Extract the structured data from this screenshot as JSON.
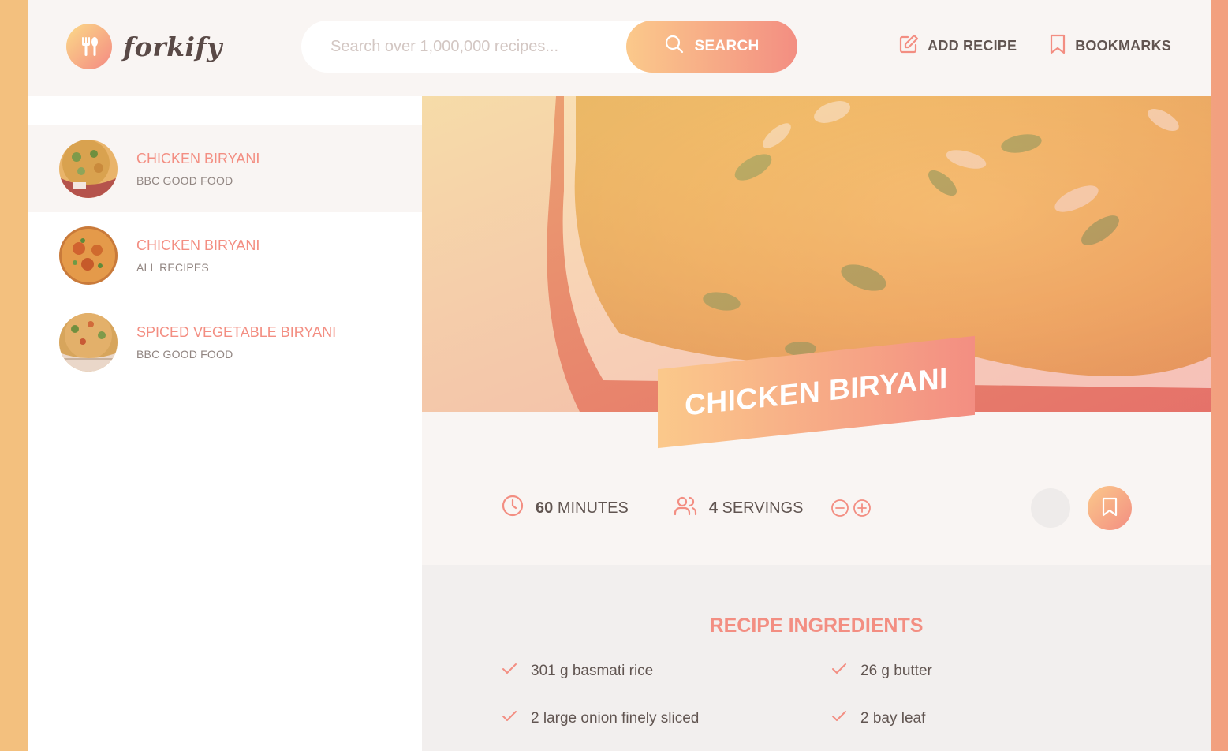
{
  "header": {
    "logo_text": "forkify",
    "search": {
      "placeholder": "Search over 1,000,000 recipes...",
      "button_label": "SEARCH"
    },
    "nav": {
      "add_recipe": "ADD RECIPE",
      "bookmarks": "BOOKMARKS"
    }
  },
  "results": [
    {
      "title": "CHICKEN BIRYANI",
      "publisher": "BBC GOOD FOOD",
      "active": true
    },
    {
      "title": "CHICKEN BIRYANI",
      "publisher": "ALL RECIPES",
      "active": false
    },
    {
      "title": "SPICED VEGETABLE BIRYANI",
      "publisher": "BBC GOOD FOOD",
      "active": false
    }
  ],
  "recipe": {
    "title": "CHICKEN BIRYANI",
    "cooking_time": "60",
    "cooking_time_unit": "MINUTES",
    "servings": "4",
    "servings_unit": "SERVINGS",
    "ingredients_heading": "RECIPE INGREDIENTS",
    "ingredients": [
      "301 g basmati rice",
      "26 g butter",
      "2 large onion finely sliced",
      "2 bay leaf"
    ]
  },
  "colors": {
    "accent_start": "#fbc98b",
    "accent_end": "#f38e82",
    "text": "#615551",
    "panel_bg": "#f9f5f3"
  },
  "icons": {
    "logo": "fork-knife-icon",
    "search": "search-icon",
    "add_recipe": "edit-icon",
    "bookmarks": "bookmark-icon",
    "time": "clock-icon",
    "servings": "users-icon",
    "decrease": "minus-circle-icon",
    "increase": "plus-circle-icon",
    "check": "check-icon"
  }
}
